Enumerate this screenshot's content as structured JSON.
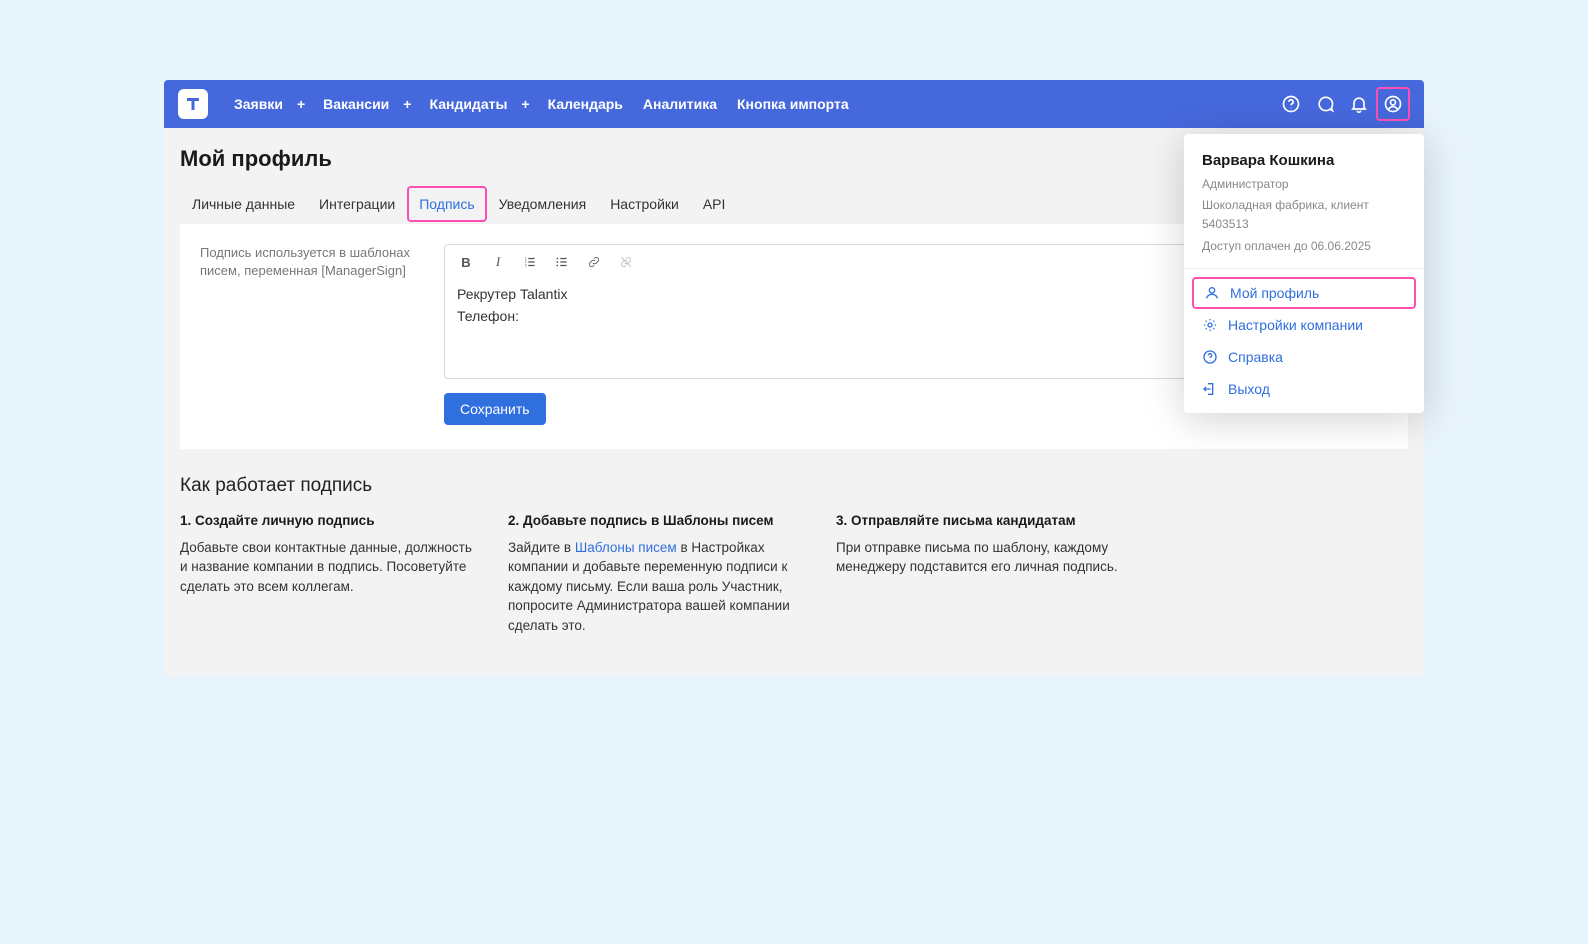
{
  "nav": {
    "items": [
      {
        "label": "Заявки",
        "plus": true
      },
      {
        "label": "Вакансии",
        "plus": true
      },
      {
        "label": "Кандидаты",
        "plus": true
      },
      {
        "label": "Календарь",
        "plus": false
      },
      {
        "label": "Аналитика",
        "plus": false
      },
      {
        "label": "Кнопка импорта",
        "plus": false
      }
    ]
  },
  "page": {
    "title": "Мой профиль"
  },
  "tabs": [
    "Личные данные",
    "Интеграции",
    "Подпись",
    "Уведомления",
    "Настройки",
    "API"
  ],
  "active_tab_index": 2,
  "signature": {
    "hint": "Подпись используется в шаблонах писем, переменная [ManagerSign]",
    "lines": [
      "Рекрутер Talantix",
      "Телефон:"
    ],
    "save_label": "Сохранить"
  },
  "how": {
    "title": "Как работает подпись",
    "steps": [
      {
        "title": "1. Создайте личную подпись",
        "text_before": "Добавьте свои контактные данные, должность и название компании в подпись. Посоветуйте сделать это всем коллегам.",
        "link_text": "",
        "text_after": ""
      },
      {
        "title": "2. Добавьте подпись в Шаблоны писем",
        "text_before": "Зайдите в ",
        "link_text": "Шаблоны писем",
        "text_after": " в Настройках компании и добавьте переменную подписи к каждому письму. Если ваша роль Участник, попросите Администратора вашей компании сделать это."
      },
      {
        "title": "3. Отправляйте письма кандидатам",
        "text_before": "При отправке письма по шаблону, каждому менеджеру подставится его личная подпись.",
        "link_text": "",
        "text_after": ""
      }
    ]
  },
  "user_dropdown": {
    "name": "Варвара Кошкина",
    "role": "Администратор",
    "company": "Шоколадная фабрика, клиент 5403513",
    "paid_until": "Доступ оплачен до 06.06.2025",
    "menu": [
      "Мой профиль",
      "Настройки компании",
      "Справка",
      "Выход"
    ]
  }
}
